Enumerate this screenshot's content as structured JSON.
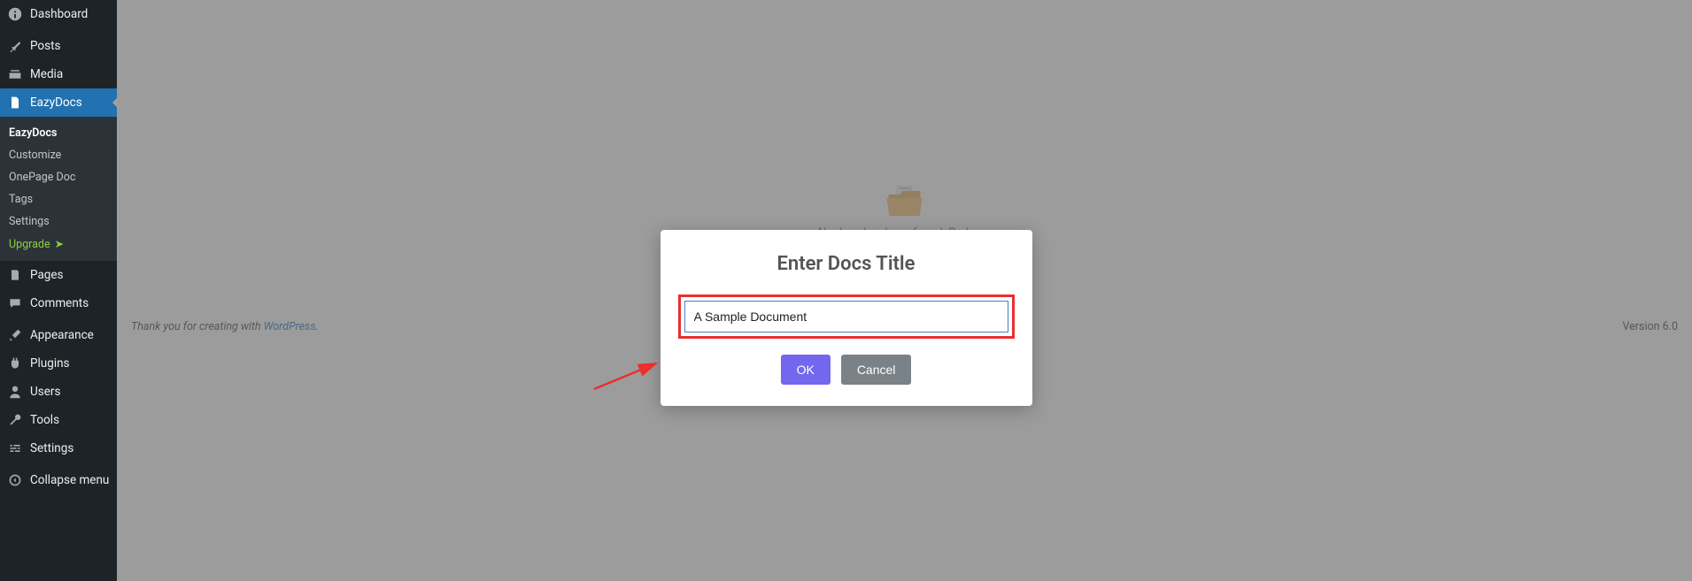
{
  "sidebar": {
    "dashboard": "Dashboard",
    "posts": "Posts",
    "media": "Media",
    "eazydocs": "EazyDocs",
    "pages": "Pages",
    "comments": "Comments",
    "appearance": "Appearance",
    "plugins": "Plugins",
    "users": "Users",
    "tools": "Tools",
    "settings": "Settings",
    "collapse": "Collapse menu"
  },
  "submenu": {
    "eazydocs": "EazyDocs",
    "customize": "Customize",
    "onepage": "OnePage Doc",
    "tags": "Tags",
    "settings": "Settings",
    "upgrade": "Upgrade"
  },
  "footer": {
    "thanks_prefix": "Thank you for creating with ",
    "wordpress": "WordPress",
    "thanks_suffix": ".",
    "version": "Version 6.0"
  },
  "empty_state": {
    "text": "No docs has been found. Perhaps"
  },
  "modal": {
    "title": "Enter Docs Title",
    "input_value": "A Sample Document",
    "ok": "OK",
    "cancel": "Cancel"
  }
}
